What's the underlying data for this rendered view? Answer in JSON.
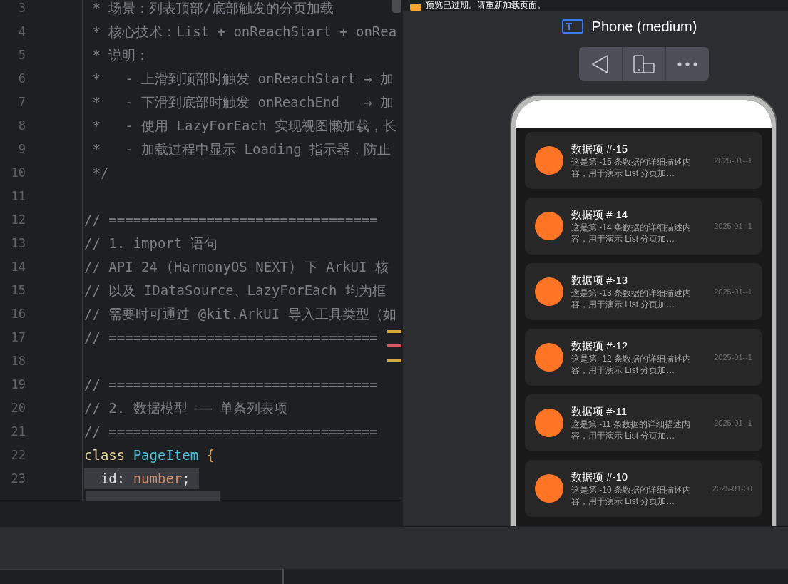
{
  "editor": {
    "lines": [
      {
        "number": "3",
        "segments": [
          {
            "text": " * 场景：列表顶部/底部触发的分页加载",
            "kind": "comment"
          }
        ]
      },
      {
        "number": "4",
        "segments": [
          {
            "text": " * 核心技术：List + onReachStart + onRea",
            "kind": "comment"
          }
        ]
      },
      {
        "number": "5",
        "segments": [
          {
            "text": " * 说明：",
            "kind": "comment"
          }
        ]
      },
      {
        "number": "6",
        "segments": [
          {
            "text": " *   - 上滑到顶部时触发 onReachStart → 加",
            "kind": "comment"
          }
        ]
      },
      {
        "number": "7",
        "segments": [
          {
            "text": " *   - 下滑到底部时触发 onReachEnd   → 加",
            "kind": "comment"
          }
        ]
      },
      {
        "number": "8",
        "segments": [
          {
            "text": " *   - 使用 LazyForEach 实现视图懒加载，长",
            "kind": "comment"
          }
        ]
      },
      {
        "number": "9",
        "segments": [
          {
            "text": " *   - 加载过程中显示 Loading 指示器，防止",
            "kind": "comment"
          }
        ]
      },
      {
        "number": "10",
        "segments": [
          {
            "text": " */",
            "kind": "comment"
          }
        ]
      },
      {
        "number": "11"
      },
      {
        "number": "12",
        "segments": [
          {
            "text": "// =================================",
            "kind": "comment"
          }
        ]
      },
      {
        "number": "13",
        "segments": [
          {
            "text": "// 1. import 语句",
            "kind": "comment"
          }
        ]
      },
      {
        "number": "14",
        "segments": [
          {
            "text": "// API 24 (HarmonyOS NEXT) 下 ArkUI 核",
            "kind": "comment"
          }
        ]
      },
      {
        "number": "15",
        "segments": [
          {
            "text": "// 以及 IDataSource、LazyForEach 均为框",
            "kind": "comment"
          }
        ]
      },
      {
        "number": "16",
        "segments": [
          {
            "text": "// 需要时可通过 @kit.ArkUI 导入工具类型（如",
            "kind": "comment"
          }
        ]
      },
      {
        "number": "17",
        "segments": [
          {
            "text": "// =================================",
            "kind": "comment"
          }
        ]
      },
      {
        "number": "18"
      },
      {
        "number": "19",
        "segments": [
          {
            "text": "// =================================",
            "kind": "comment"
          }
        ]
      },
      {
        "number": "20",
        "segments": [
          {
            "text": "// 2. 数据模型 —— 单条列表项",
            "kind": "comment"
          }
        ]
      },
      {
        "number": "21",
        "segments": [
          {
            "text": "// =================================",
            "kind": "comment"
          }
        ]
      },
      {
        "number": "22",
        "segments": [
          {
            "text": "class",
            "kind": "keyword"
          },
          {
            "text": " PageItem",
            "kind": "type"
          },
          {
            "text": " {",
            "kind": "brace"
          }
        ]
      },
      {
        "number": "23",
        "segments": [
          {
            "text": "  id:",
            "kind": "plain"
          },
          {
            "text": " number",
            "kind": "builtin"
          },
          {
            "text": ";",
            "kind": "plain"
          }
        ]
      }
    ]
  },
  "preview": {
    "banner": "预览已过期。请重新加载页面。",
    "device": "Phone (medium)",
    "items": [
      {
        "title": "数据项 #-15",
        "description": "这是第 -15 条数据的详细描述内容，用于演示 List 分页加…",
        "date": "2025-01--1"
      },
      {
        "title": "数据项 #-14",
        "description": "这是第 -14 条数据的详细描述内容，用于演示 List 分页加…",
        "date": "2025-01--1"
      },
      {
        "title": "数据项 #-13",
        "description": "这是第 -13 条数据的详细描述内容，用于演示 List 分页加…",
        "date": "2025-01--1"
      },
      {
        "title": "数据项 #-12",
        "description": "这是第 -12 条数据的详细描述内容，用于演示 List 分页加…",
        "date": "2025-01--1"
      },
      {
        "title": "数据项 #-11",
        "description": "这是第 -11 条数据的详细描述内容，用于演示 List 分页加…",
        "date": "2025-01--1"
      },
      {
        "title": "数据项 #-10",
        "description": "这是第 -10 条数据的详细描述内容，用于演示 List 分页加…",
        "date": "2025-01-00"
      }
    ]
  }
}
